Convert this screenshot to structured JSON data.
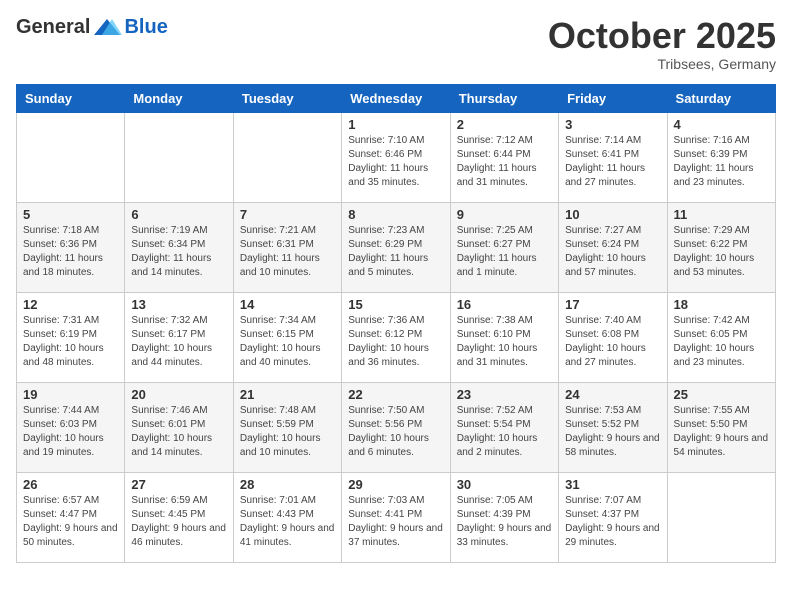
{
  "logo": {
    "general": "General",
    "blue": "Blue"
  },
  "title": "October 2025",
  "location": "Tribsees, Germany",
  "headers": [
    "Sunday",
    "Monday",
    "Tuesday",
    "Wednesday",
    "Thursday",
    "Friday",
    "Saturday"
  ],
  "weeks": [
    [
      {
        "day": "",
        "info": ""
      },
      {
        "day": "",
        "info": ""
      },
      {
        "day": "",
        "info": ""
      },
      {
        "day": "1",
        "info": "Sunrise: 7:10 AM\nSunset: 6:46 PM\nDaylight: 11 hours\nand 35 minutes."
      },
      {
        "day": "2",
        "info": "Sunrise: 7:12 AM\nSunset: 6:44 PM\nDaylight: 11 hours\nand 31 minutes."
      },
      {
        "day": "3",
        "info": "Sunrise: 7:14 AM\nSunset: 6:41 PM\nDaylight: 11 hours\nand 27 minutes."
      },
      {
        "day": "4",
        "info": "Sunrise: 7:16 AM\nSunset: 6:39 PM\nDaylight: 11 hours\nand 23 minutes."
      }
    ],
    [
      {
        "day": "5",
        "info": "Sunrise: 7:18 AM\nSunset: 6:36 PM\nDaylight: 11 hours\nand 18 minutes."
      },
      {
        "day": "6",
        "info": "Sunrise: 7:19 AM\nSunset: 6:34 PM\nDaylight: 11 hours\nand 14 minutes."
      },
      {
        "day": "7",
        "info": "Sunrise: 7:21 AM\nSunset: 6:31 PM\nDaylight: 11 hours\nand 10 minutes."
      },
      {
        "day": "8",
        "info": "Sunrise: 7:23 AM\nSunset: 6:29 PM\nDaylight: 11 hours\nand 5 minutes."
      },
      {
        "day": "9",
        "info": "Sunrise: 7:25 AM\nSunset: 6:27 PM\nDaylight: 11 hours\nand 1 minute."
      },
      {
        "day": "10",
        "info": "Sunrise: 7:27 AM\nSunset: 6:24 PM\nDaylight: 10 hours\nand 57 minutes."
      },
      {
        "day": "11",
        "info": "Sunrise: 7:29 AM\nSunset: 6:22 PM\nDaylight: 10 hours\nand 53 minutes."
      }
    ],
    [
      {
        "day": "12",
        "info": "Sunrise: 7:31 AM\nSunset: 6:19 PM\nDaylight: 10 hours\nand 48 minutes."
      },
      {
        "day": "13",
        "info": "Sunrise: 7:32 AM\nSunset: 6:17 PM\nDaylight: 10 hours\nand 44 minutes."
      },
      {
        "day": "14",
        "info": "Sunrise: 7:34 AM\nSunset: 6:15 PM\nDaylight: 10 hours\nand 40 minutes."
      },
      {
        "day": "15",
        "info": "Sunrise: 7:36 AM\nSunset: 6:12 PM\nDaylight: 10 hours\nand 36 minutes."
      },
      {
        "day": "16",
        "info": "Sunrise: 7:38 AM\nSunset: 6:10 PM\nDaylight: 10 hours\nand 31 minutes."
      },
      {
        "day": "17",
        "info": "Sunrise: 7:40 AM\nSunset: 6:08 PM\nDaylight: 10 hours\nand 27 minutes."
      },
      {
        "day": "18",
        "info": "Sunrise: 7:42 AM\nSunset: 6:05 PM\nDaylight: 10 hours\nand 23 minutes."
      }
    ],
    [
      {
        "day": "19",
        "info": "Sunrise: 7:44 AM\nSunset: 6:03 PM\nDaylight: 10 hours\nand 19 minutes."
      },
      {
        "day": "20",
        "info": "Sunrise: 7:46 AM\nSunset: 6:01 PM\nDaylight: 10 hours\nand 14 minutes."
      },
      {
        "day": "21",
        "info": "Sunrise: 7:48 AM\nSunset: 5:59 PM\nDaylight: 10 hours\nand 10 minutes."
      },
      {
        "day": "22",
        "info": "Sunrise: 7:50 AM\nSunset: 5:56 PM\nDaylight: 10 hours\nand 6 minutes."
      },
      {
        "day": "23",
        "info": "Sunrise: 7:52 AM\nSunset: 5:54 PM\nDaylight: 10 hours\nand 2 minutes."
      },
      {
        "day": "24",
        "info": "Sunrise: 7:53 AM\nSunset: 5:52 PM\nDaylight: 9 hours\nand 58 minutes."
      },
      {
        "day": "25",
        "info": "Sunrise: 7:55 AM\nSunset: 5:50 PM\nDaylight: 9 hours\nand 54 minutes."
      }
    ],
    [
      {
        "day": "26",
        "info": "Sunrise: 6:57 AM\nSunset: 4:47 PM\nDaylight: 9 hours\nand 50 minutes."
      },
      {
        "day": "27",
        "info": "Sunrise: 6:59 AM\nSunset: 4:45 PM\nDaylight: 9 hours\nand 46 minutes."
      },
      {
        "day": "28",
        "info": "Sunrise: 7:01 AM\nSunset: 4:43 PM\nDaylight: 9 hours\nand 41 minutes."
      },
      {
        "day": "29",
        "info": "Sunrise: 7:03 AM\nSunset: 4:41 PM\nDaylight: 9 hours\nand 37 minutes."
      },
      {
        "day": "30",
        "info": "Sunrise: 7:05 AM\nSunset: 4:39 PM\nDaylight: 9 hours\nand 33 minutes."
      },
      {
        "day": "31",
        "info": "Sunrise: 7:07 AM\nSunset: 4:37 PM\nDaylight: 9 hours\nand 29 minutes."
      },
      {
        "day": "",
        "info": ""
      }
    ]
  ]
}
